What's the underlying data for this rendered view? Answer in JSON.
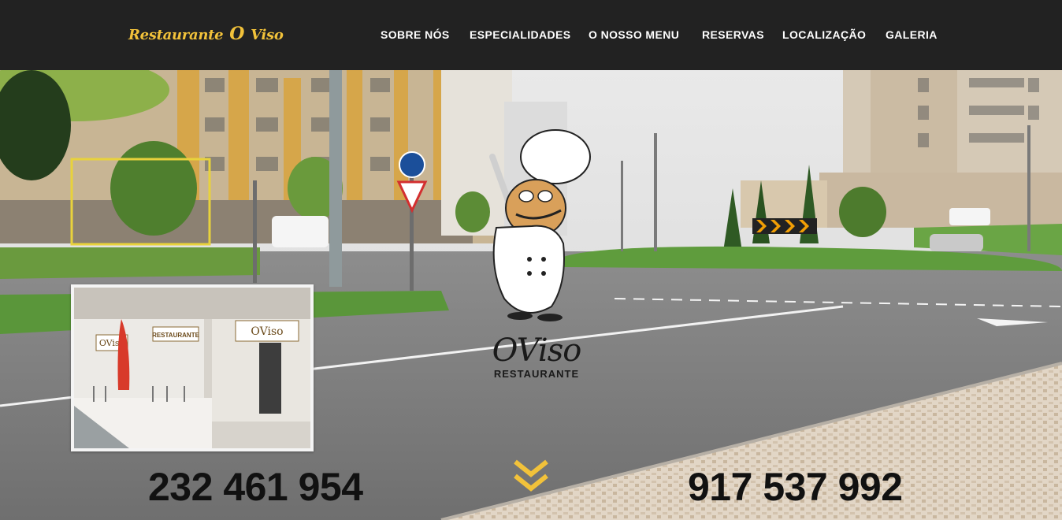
{
  "header": {
    "brand": {
      "word1": "Restaurante",
      "word2": "O",
      "word3": "Viso"
    },
    "nav": [
      {
        "label": "SOBRE NÓS"
      },
      {
        "label": "ESPECIALIDADES"
      },
      {
        "label": "O NOSSO MENU"
      },
      {
        "label": "RESERVAS"
      },
      {
        "label": "LOCALIZAÇÃO"
      },
      {
        "label": "GALERIA"
      }
    ]
  },
  "hero": {
    "logo": {
      "name": "OViso",
      "subtitle": "RESTAURANTE"
    },
    "phones": {
      "landline": "232 461 954",
      "mobile": "917 537 992"
    },
    "storefront_signs": {
      "left": "OViso",
      "middle": "RESTAURANTE",
      "right": "OViso"
    },
    "scroll_icon": "double-chevron-down-icon"
  },
  "colors": {
    "accent": "#f2c23a",
    "header_bg": "#222222",
    "phone_text": "#111111"
  }
}
